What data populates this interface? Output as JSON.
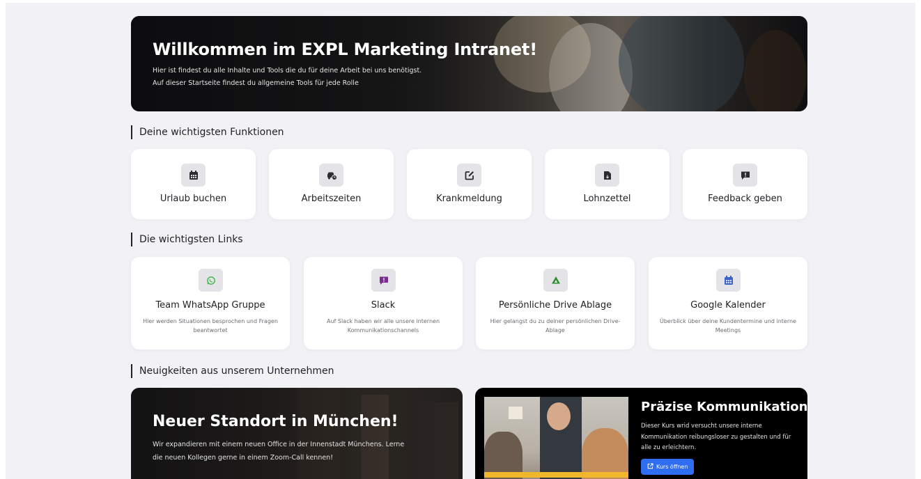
{
  "hero": {
    "title": "Willkommen im EXPL Marketing Intranet!",
    "line1": "Hier ist findest du alle Inhalte und Tools die du für deine Arbeit bei uns benötigst.",
    "line2": "Auf dieser Startseite findest du allgemeine Tools für jede Rolle"
  },
  "functions": {
    "heading": "Deine wichtigsten Funktionen",
    "items": [
      {
        "label": "Urlaub buchen",
        "icon": "calendar-icon"
      },
      {
        "label": "Arbeitszeiten",
        "icon": "car-clock-icon"
      },
      {
        "label": "Krankmeldung",
        "icon": "edit-icon"
      },
      {
        "label": "Lohnzettel",
        "icon": "file-icon"
      },
      {
        "label": "Feedback geben",
        "icon": "message-alert-icon"
      }
    ]
  },
  "links": {
    "heading": "Die wichtigsten Links",
    "items": [
      {
        "title": "Team WhatsApp Gruppe",
        "desc": "Hier werden Situationen besprochen und Fragen beantwortet",
        "icon": "whatsapp-icon",
        "color": "#3cb64a"
      },
      {
        "title": "Slack",
        "desc": "Auf Slack haben wir alle unsere internen Kommunikationschannels",
        "icon": "slack-icon",
        "color": "#7b2c8f"
      },
      {
        "title": "Persönliche Drive Ablage",
        "desc": "Hier gelangst du zu deiner persönlichen Drive-Ablage",
        "icon": "google-drive-icon",
        "color": "#2f8f2f"
      },
      {
        "title": "Google Kalender",
        "desc": "Überblick über deine Kundentermine und interne Meetings",
        "icon": "google-calendar-icon",
        "color": "#3b63c8"
      }
    ]
  },
  "news": {
    "heading": "Neuigkeiten aus unserem Unternehmen",
    "card1": {
      "title": "Neuer Standort in München!",
      "line1": "Wir expandieren mit einem neuen Office in der Innenstadt Münchens. Lerne",
      "line2": "die neuen Kollegen gerne in einem Zoom-Call kennen!"
    },
    "card2": {
      "title": "Präzise Kommunikation",
      "desc": "Dieser Kurs wrid versucht unsere interne Kommunikation reibungsloser zu gestalten und für alle zu erleichtern.",
      "button": "Kurs öffnen",
      "accent": "#2f6ef0"
    }
  }
}
